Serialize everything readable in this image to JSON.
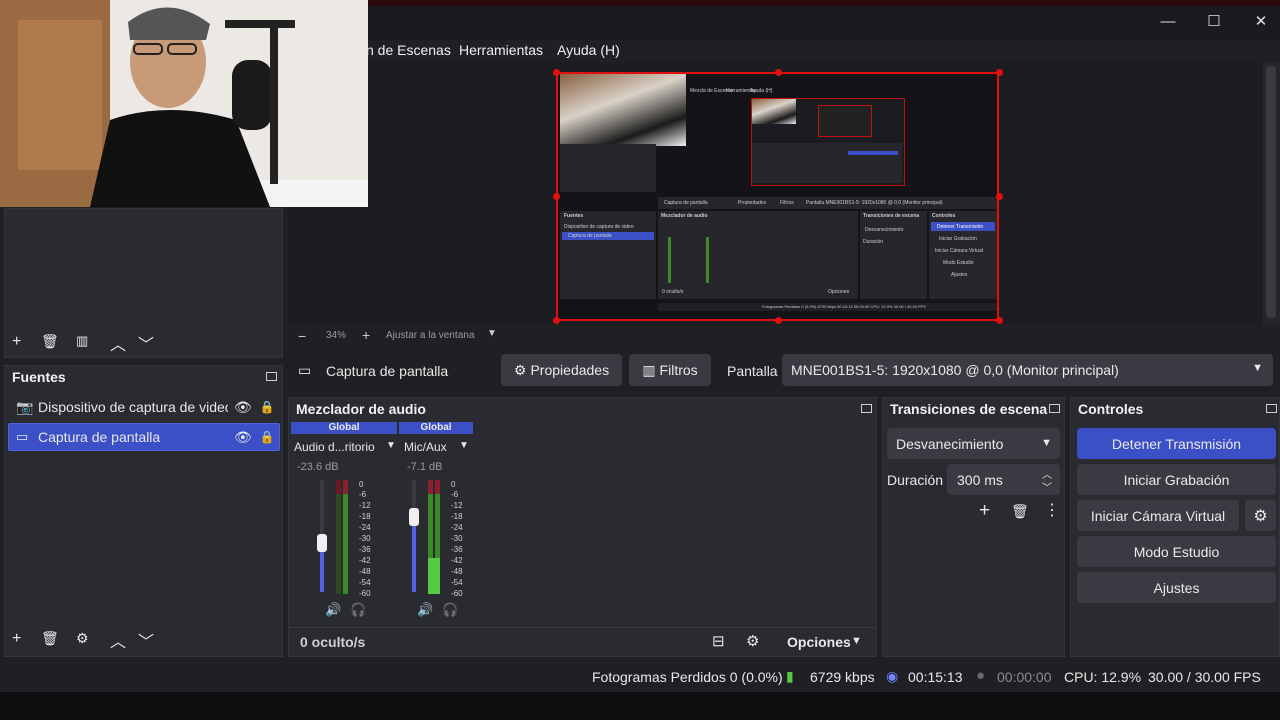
{
  "menu": {
    "scenes_partial": "n de Escenas",
    "tools": "Herramientas",
    "help": "Ayuda (H)"
  },
  "window": {
    "minimize": "—",
    "maximize": "☐",
    "close": "✕"
  },
  "preview": {
    "zoom": "34%",
    "fit": "Ajustar a la ventana",
    "nested": {
      "menu_a": "Mezcla de Escenas",
      "menu_b": "Herramientas",
      "menu_c": "Ayuda (H)",
      "sources_title": "Fuentes",
      "source1": "Dispositivo de captura de video",
      "source2": "Captura de pantalla",
      "mixer_title": "Mezclador de audio",
      "transitions_title": "Transiciones de escena",
      "controls_title": "Controles",
      "ctrl1": "Detener Transmisión",
      "ctrl2": "Iniciar Grabación",
      "ctrl3": "Iniciar Cámara Virtual",
      "ctrl4": "Modo Estudio",
      "ctrl5": "Ajustes",
      "fade": "Desvanecimiento",
      "duration": "Duración",
      "props": "Propiedades",
      "filters": "Filtros",
      "screen": "Pantalla MNE001BS1-5: 1920x1080 @ 0,0 (Monitor principal)",
      "hidden": "0 oculto/s",
      "options": "Opciones",
      "status": "Fotogramas Perdidos 0 (0.0%)  6729 kbps  00:15:13  00:00:00  CPU: 12.9%  30.00 / 30.00 FPS"
    }
  },
  "source_bar": {
    "selected": "Captura de pantalla",
    "properties": "Propiedades",
    "filters": "Filtros",
    "screen_label": "Pantalla",
    "screen_value": "MNE001BS1-5: 1920x1080 @ 0,0 (Monitor principal)"
  },
  "sources": {
    "title": "Fuentes",
    "items": [
      {
        "label": "Dispositivo de captura de video"
      },
      {
        "label": "Captura de pantalla"
      }
    ]
  },
  "mixer": {
    "title": "Mezclador de audio",
    "channels": [
      {
        "tag": "Global",
        "name": "Audio d...ritorio",
        "db": "-23.6 dB",
        "level": 0.55
      },
      {
        "tag": "Global",
        "name": "Mic/Aux",
        "db": "-7.1 dB",
        "level": 0.75
      }
    ],
    "scale": [
      "0",
      "-6",
      "-12",
      "-18",
      "-24",
      "-30",
      "-36",
      "-42",
      "-48",
      "-54",
      "-60"
    ],
    "hidden": "0 oculto/s",
    "options": "Opciones"
  },
  "transitions": {
    "title": "Transiciones de escena",
    "selected": "Desvanecimiento",
    "duration_label": "Duración",
    "duration_value": "300 ms"
  },
  "controls": {
    "title": "Controles",
    "stop_stream": "Detener Transmisión",
    "start_record": "Iniciar Grabación",
    "start_vcam": "Iniciar Cámara Virtual",
    "studio_mode": "Modo Estudio",
    "settings": "Ajustes"
  },
  "status": {
    "dropped": "Fotogramas Perdidos 0 (0.0%)",
    "bitrate": "6729 kbps",
    "stream_time": "00:15:13",
    "record_time": "00:00:00",
    "cpu": "CPU: 12.9%",
    "fps": "30.00 / 30.00 FPS"
  },
  "colors": {
    "accent": "#3b4fc6",
    "red_frame": "#e01010",
    "meter_green": "#3b8a2a"
  }
}
